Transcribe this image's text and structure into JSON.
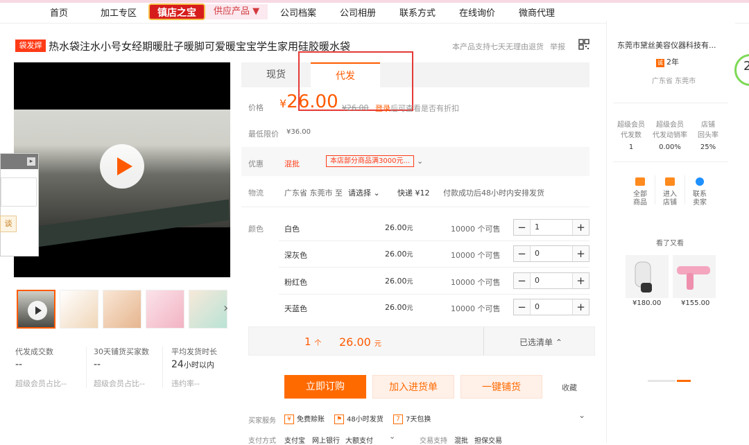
{
  "nav": {
    "items": [
      "首页",
      "加工专区",
      "镇店之宝",
      "供应产品 ▼",
      "公司档案",
      "公司相册",
      "联系方式",
      "在线询价",
      "微商代理"
    ]
  },
  "product": {
    "tag": "袋发焊",
    "title": "热水袋注水小号女经期暖肚子暖脚可爱暖宝宝学生家用硅胶暖水袋",
    "return_policy": "本产品支持七天无理由退货",
    "report": "举报"
  },
  "tabs": [
    "现货",
    "代发"
  ],
  "price": {
    "label": "价格",
    "symbol": "¥",
    "value": "26.00",
    "strike": "¥26.00",
    "login_note_a": "登录",
    "login_note_b": "后可查看是否有折扣",
    "min_label": "最低限价",
    "min_value": "¥36.00"
  },
  "promo": {
    "label": "优惠",
    "type": "混批",
    "text": "本店部分商品满3000元..."
  },
  "logistics": {
    "label": "物流",
    "from": "广东省 东莞市",
    "to_word": "至",
    "select": "请选择",
    "express": "快递 ¥12",
    "ship": "付款成功后48小时内安排发货"
  },
  "colors": {
    "label": "颜色",
    "unit": "元",
    "stock_suffix": "个可售",
    "options": [
      {
        "name": "白色",
        "price": "26.00",
        "stock": "10000",
        "qty": "1"
      },
      {
        "name": "深灰色",
        "price": "26.00",
        "stock": "10000",
        "qty": "0"
      },
      {
        "name": "粉红色",
        "price": "26.00",
        "stock": "10000",
        "qty": "0"
      },
      {
        "name": "天蓝色",
        "price": "26.00",
        "stock": "10000",
        "qty": "0"
      }
    ]
  },
  "summary": {
    "count": "1",
    "count_unit": "个",
    "total": "26.00",
    "total_unit": "元",
    "chosen": "已选清单 ⌃"
  },
  "actions": {
    "buy": "立即订购",
    "add_list": "加入进货单",
    "one_click": "一键铺货",
    "fav": "收藏"
  },
  "services": {
    "label": "买家服务",
    "items": [
      "免费赊账",
      "48小时发货",
      "7天包换"
    ],
    "pay_label": "支付方式",
    "pay_items": [
      "支付宝",
      "网上银行",
      "大额支付"
    ],
    "trade_label": "交易支持",
    "trade_items": [
      "混批",
      "担保交易"
    ]
  },
  "left_stats": [
    {
      "label": "代发成交数",
      "value": "--",
      "sub": "超级会员占比--"
    },
    {
      "label": "30天铺货买家数",
      "value": "--",
      "sub": "超级会员占比--"
    },
    {
      "label": "平均发货时长",
      "value": "24",
      "value_suffix": "小时以内",
      "sub": "违约率--"
    }
  ],
  "chat": {
    "btn": "谈"
  },
  "sidebar": {
    "company": "东莞市黛丝美容仪器科技有...",
    "years": "2年",
    "years_logo": "诚",
    "location": "广东省 东莞市",
    "stats": [
      {
        "label1": "超级会员",
        "label2": "代发数",
        "value": "1"
      },
      {
        "label1": "超级会员",
        "label2": "代发动销率",
        "value": "0.00%"
      },
      {
        "label1": "店铺",
        "label2": "回头率",
        "value": "25%"
      }
    ],
    "links": [
      {
        "l1": "全部",
        "l2": "商品"
      },
      {
        "l1": "进入",
        "l2": "店铺"
      },
      {
        "l1": "联系",
        "l2": "卖家"
      }
    ],
    "also": "看了又看",
    "products": [
      {
        "price": "¥180.00"
      },
      {
        "price": "¥155.00"
      }
    ],
    "badge": "2"
  }
}
